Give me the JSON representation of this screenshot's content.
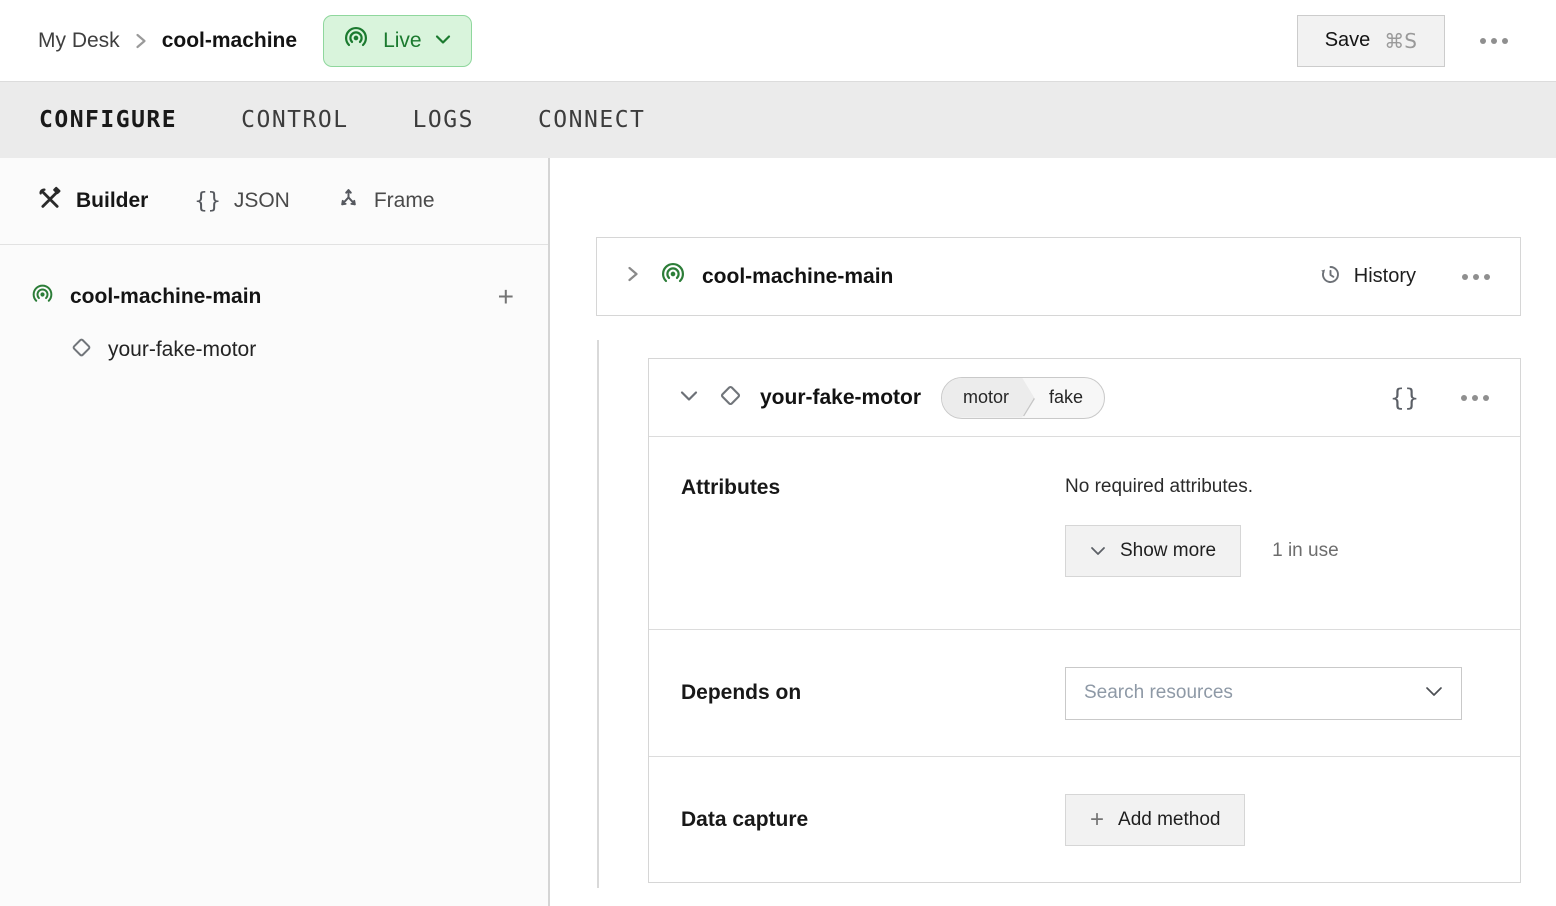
{
  "colors": {
    "live_badge_bg": "#d9f4dc",
    "live_badge_border": "#8fd79d",
    "live_green_text": "#1b7a2f",
    "machine_icon_green": "#2c7d38",
    "tabbar_bg": "#ebebeb",
    "button_bg": "#f2f2f2"
  },
  "header": {
    "breadcrumb": {
      "parent": "My Desk",
      "machine": "cool-machine"
    },
    "live_badge": {
      "label": "Live"
    },
    "save_button": {
      "label": "Save",
      "shortcut": "⌘S"
    }
  },
  "tabs": [
    {
      "label": "CONFIGURE",
      "active": true
    },
    {
      "label": "CONTROL",
      "active": false
    },
    {
      "label": "LOGS",
      "active": false
    },
    {
      "label": "CONNECT",
      "active": false
    }
  ],
  "sidebar": {
    "modes": [
      {
        "label": "Builder",
        "active": true
      },
      {
        "label": "JSON",
        "active": false
      },
      {
        "label": "Frame",
        "active": false
      }
    ],
    "tree": {
      "part": {
        "label": "cool-machine-main"
      },
      "component": {
        "label": "your-fake-motor"
      }
    }
  },
  "main": {
    "part_card": {
      "title": "cool-machine-main",
      "history_label": "History"
    },
    "component_card": {
      "title": "your-fake-motor",
      "type_badge": {
        "type": "motor",
        "model": "fake"
      },
      "attributes": {
        "label": "Attributes",
        "empty_text": "No required attributes.",
        "show_more_label": "Show more",
        "usage_text": "1 in use"
      },
      "depends_on": {
        "label": "Depends on",
        "placeholder": "Search resources"
      },
      "data_capture": {
        "label": "Data capture",
        "add_method_label": "Add method"
      }
    }
  },
  "icons": {
    "braces": "{}",
    "plus": "+"
  }
}
